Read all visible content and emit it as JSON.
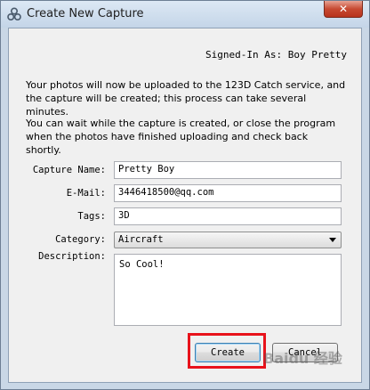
{
  "window": {
    "title": "Create New Capture",
    "close_glyph": "✕"
  },
  "header": {
    "signed_in": "Signed-In As: Boy Pretty"
  },
  "info": {
    "para1": "Your photos will now be uploaded to the 123D Catch service, and the capture will be created; this process can take several minutes.",
    "para2": "You can wait while the capture is created, or close the program when the photos have finished uploading and check back shortly."
  },
  "form": {
    "capture_name_label": "Capture Name:",
    "capture_name_value": "Pretty Boy",
    "email_label": "E-Mail:",
    "email_value": "3446418500@qq.com",
    "tags_label": "Tags:",
    "tags_value": "3D",
    "category_label": "Category:",
    "category_value": "Aircraft",
    "description_label": "Description:",
    "description_value": "So Cool!"
  },
  "buttons": {
    "create": "Create",
    "cancel": "Cancel"
  },
  "watermark": "Baidu 经验",
  "colors": {
    "highlight": "#e8121b",
    "titlebar": "#c9d7e6"
  }
}
